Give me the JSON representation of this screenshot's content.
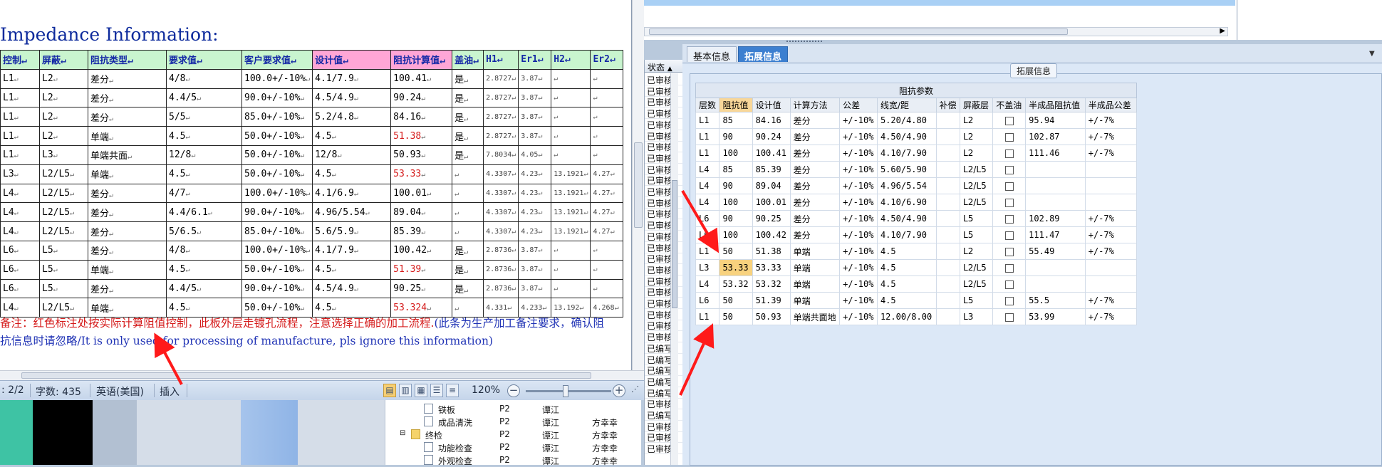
{
  "doc": {
    "title": "Impedance Information:",
    "headers": [
      "控制",
      "屏蔽",
      "阻抗类型",
      "要求值",
      "客户要求值",
      "设计值",
      "阻抗计算值",
      "盖油",
      "H1",
      "Er1",
      "H2",
      "Er2"
    ],
    "rows": [
      [
        "L1",
        "L2",
        "差分",
        "4/8",
        "100.0+/-10%",
        "4.1/7.9",
        "100.41",
        "是",
        "2.8727",
        "3.87",
        "",
        ""
      ],
      [
        "L1",
        "L2",
        "差分",
        "4.4/5",
        "90.0+/-10%",
        "4.5/4.9",
        "90.24",
        "是",
        "2.8727",
        "3.87",
        "",
        ""
      ],
      [
        "L1",
        "L2",
        "差分",
        "5/5",
        "85.0+/-10%",
        "5.2/4.8",
        "84.16",
        "是",
        "2.8727",
        "3.87",
        "",
        ""
      ],
      [
        "L1",
        "L2",
        "单端",
        "4.5",
        "50.0+/-10%",
        "4.5",
        "51.38",
        "是",
        "2.8727",
        "3.87",
        "",
        ""
      ],
      [
        "L1",
        "L3",
        "单端共面",
        "12/8",
        "50.0+/-10%",
        "12/8",
        "50.93",
        "是",
        "7.8034",
        "4.05",
        "",
        ""
      ],
      [
        "L3",
        "L2/L5",
        "单端",
        "4.5",
        "50.0+/-10%",
        "4.5",
        "53.33",
        "",
        "4.3307",
        "4.23",
        "13.1921",
        "4.27"
      ],
      [
        "L4",
        "L2/L5",
        "差分",
        "4/7",
        "100.0+/-10%",
        "4.1/6.9",
        "100.01",
        "",
        "4.3307",
        "4.23",
        "13.1921",
        "4.27"
      ],
      [
        "L4",
        "L2/L5",
        "差分",
        "4.4/6.1",
        "90.0+/-10%",
        "4.96/5.54",
        "89.04",
        "",
        "4.3307",
        "4.23",
        "13.1921",
        "4.27"
      ],
      [
        "L4",
        "L2/L5",
        "差分",
        "5/6.5",
        "85.0+/-10%",
        "5.6/5.9",
        "85.39",
        "",
        "4.3307",
        "4.23",
        "13.1921",
        "4.27"
      ],
      [
        "L6",
        "L5",
        "差分",
        "4/8",
        "100.0+/-10%",
        "4.1/7.9",
        "100.42",
        "是",
        "2.8736",
        "3.87",
        "",
        ""
      ],
      [
        "L6",
        "L5",
        "单端",
        "4.5",
        "50.0+/-10%",
        "4.5",
        "51.39",
        "是",
        "2.8736",
        "3.87",
        "",
        ""
      ],
      [
        "L6",
        "L5",
        "差分",
        "4.4/5",
        "90.0+/-10%",
        "4.5/4.9",
        "90.25",
        "是",
        "2.8736",
        "3.87",
        "",
        ""
      ],
      [
        "L4",
        "L2/L5",
        "单端",
        "4.5",
        "50.0+/-10%",
        "4.5",
        "53.324",
        "",
        "4.331",
        "4.233",
        "13.192",
        "4.268"
      ]
    ],
    "red_rows": [
      3,
      5,
      10,
      12
    ],
    "note_red": "备注：红色标注处按实际计算阻值控制，此板外层走镀孔流程，注意选择正确的加工流程.",
    "note_blue": "(此条为生产加工备注要求，确认阻抗信息时请忽略/It is only used for processing of manufacture, pls ignore this information)"
  },
  "statusbar": {
    "page": ": 2/2",
    "words": "字数: 435",
    "language": "英语(美国)",
    "insert": "插入",
    "zoom": "120%"
  },
  "tree": {
    "rows": [
      {
        "name": "铁板",
        "code": "P2",
        "dept": "谭江",
        "user": ""
      },
      {
        "name": "成品清洗",
        "code": "P2",
        "dept": "谭江",
        "user": "方幸幸"
      },
      {
        "name": "终检",
        "code": "P2",
        "dept": "谭江",
        "user": "方幸幸"
      },
      {
        "name": "功能检查",
        "code": "P2",
        "dept": "谭江",
        "user": "方幸幸"
      },
      {
        "name": "外观检查",
        "code": "P2",
        "dept": "谭江",
        "user": "方幸幸"
      }
    ]
  },
  "midcol": {
    "header": "状态",
    "cells": [
      "已审核",
      "已审核",
      "已审核",
      "已审核",
      "已审核",
      "已审核",
      "已审核",
      "已审核",
      "已审核",
      "已审核",
      "已审核",
      "已审核",
      "已审核",
      "已审核",
      "已审核",
      "已审核",
      "已审核",
      "已审核",
      "已审核",
      "已审核",
      "已审核",
      "已审核",
      "已审核",
      "已审核",
      "已编写",
      "已编写",
      "已编写",
      "已编写",
      "已编写",
      "已审核",
      "已编写",
      "已审核",
      "已审核",
      "已审核"
    ]
  },
  "tabs": {
    "basic": "基本信息",
    "extended": "拓展信息"
  },
  "panel": {
    "group_label": "拓展信息",
    "table_caption": "阻抗参数",
    "headers": [
      "层数",
      "阻抗值",
      "设计值",
      "计算方法",
      "公差",
      "线宽/距",
      "补偿",
      "屏蔽层",
      "不盖油",
      "半成品阻抗值",
      "半成品公差"
    ],
    "rows": [
      [
        "L1",
        "85",
        "84.16",
        "差分",
        "+/-10%",
        "5.20/4.80",
        "",
        "L2",
        "",
        "95.94",
        "+/-7%"
      ],
      [
        "L1",
        "90",
        "90.24",
        "差分",
        "+/-10%",
        "4.50/4.90",
        "",
        "L2",
        "",
        "102.87",
        "+/-7%"
      ],
      [
        "L1",
        "100",
        "100.41",
        "差分",
        "+/-10%",
        "4.10/7.90",
        "",
        "L2",
        "",
        "111.46",
        "+/-7%"
      ],
      [
        "L4",
        "85",
        "85.39",
        "差分",
        "+/-10%",
        "5.60/5.90",
        "",
        "L2/L5",
        "",
        "",
        ""
      ],
      [
        "L4",
        "90",
        "89.04",
        "差分",
        "+/-10%",
        "4.96/5.54",
        "",
        "L2/L5",
        "",
        "",
        ""
      ],
      [
        "L4",
        "100",
        "100.01",
        "差分",
        "+/-10%",
        "4.10/6.90",
        "",
        "L2/L5",
        "",
        "",
        ""
      ],
      [
        "L6",
        "90",
        "90.25",
        "差分",
        "+/-10%",
        "4.50/4.90",
        "",
        "L5",
        "",
        "102.89",
        "+/-7%"
      ],
      [
        "L6",
        "100",
        "100.42",
        "差分",
        "+/-10%",
        "4.10/7.90",
        "",
        "L5",
        "",
        "111.47",
        "+/-7%"
      ],
      [
        "L1",
        "50",
        "51.38",
        "单端",
        "+/-10%",
        "4.5",
        "",
        "L2",
        "",
        "55.49",
        "+/-7%"
      ],
      [
        "L3",
        "53.33",
        "53.33",
        "单端",
        "+/-10%",
        "4.5",
        "",
        "L2/L5",
        "",
        "",
        ""
      ],
      [
        "L4",
        "53.32",
        "53.32",
        "单端",
        "+/-10%",
        "4.5",
        "",
        "L2/L5",
        "",
        "",
        ""
      ],
      [
        "L6",
        "50",
        "51.39",
        "单端",
        "+/-10%",
        "4.5",
        "",
        "L5",
        "",
        "55.5",
        "+/-7%"
      ],
      [
        "L1",
        "50",
        "50.93",
        "单端共面地",
        "+/-10%",
        "12.00/8.00",
        "",
        "L3",
        "",
        "53.99",
        "+/-7%"
      ]
    ],
    "highlight_row": 9
  },
  "colors": {
    "arrow": "#ff1a1a",
    "tab_active": "#3c7fd0",
    "doc_title": "#0d2a9c"
  }
}
